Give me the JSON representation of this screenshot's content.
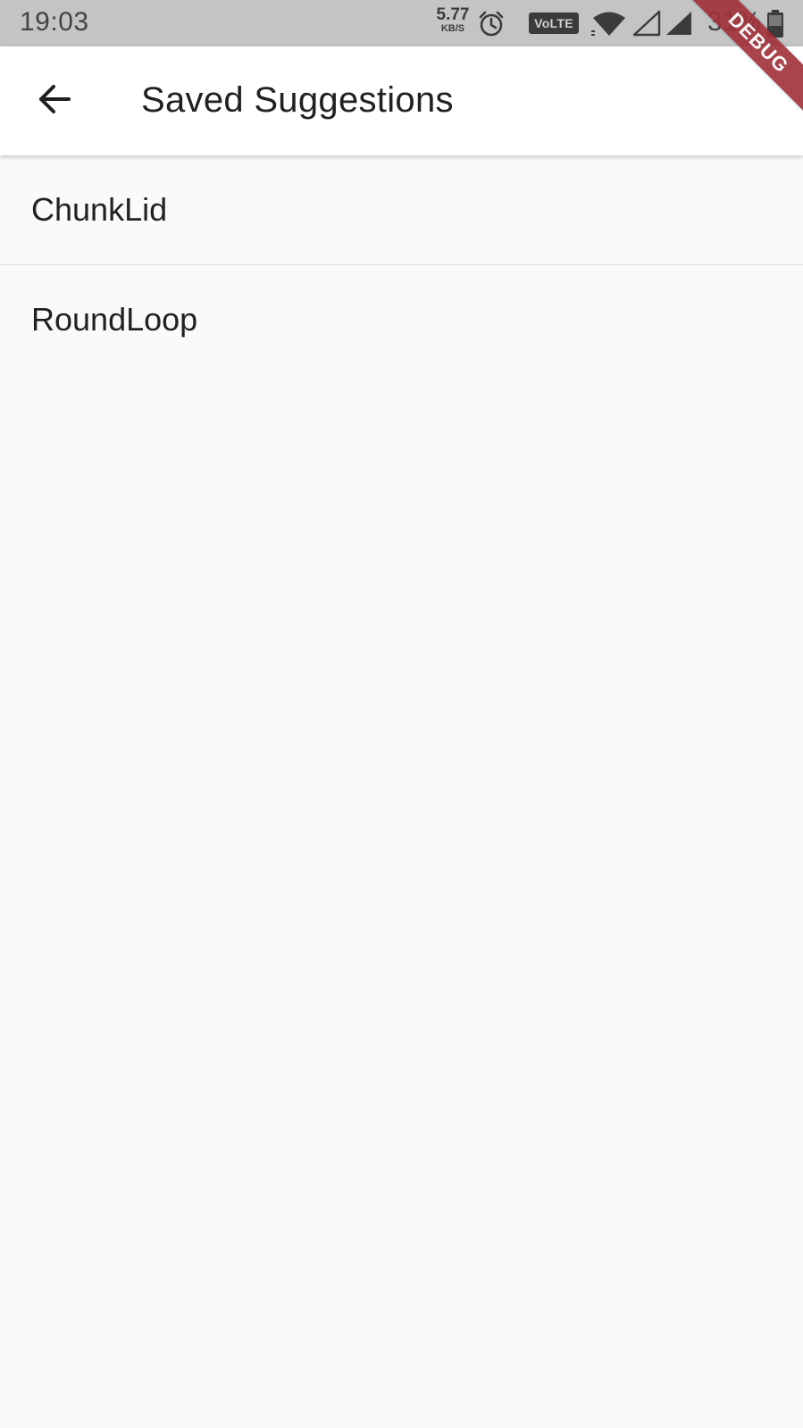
{
  "status_bar": {
    "time": "19:03",
    "net_speed_value": "5.77",
    "net_speed_unit": "KB/S",
    "volte_label": "VoLTE",
    "battery_percent": "31%",
    "icons": [
      "alarm-icon",
      "volte-icon",
      "wifi-icon",
      "signal-empty-icon",
      "signal-full-icon",
      "battery-icon"
    ]
  },
  "app_bar": {
    "back_icon": "arrow-left-icon",
    "title": "Saved Suggestions"
  },
  "saved_list": {
    "items": [
      {
        "label": "ChunkLid"
      },
      {
        "label": "RoundLoop"
      }
    ]
  },
  "debug_banner": {
    "label": "DEBUG",
    "color": "#a0303a"
  },
  "colors": {
    "status_bar_bg": "#c4c4c4",
    "app_bar_bg": "#ffffff",
    "body_bg": "#fafafa",
    "text_primary": "#212121"
  }
}
